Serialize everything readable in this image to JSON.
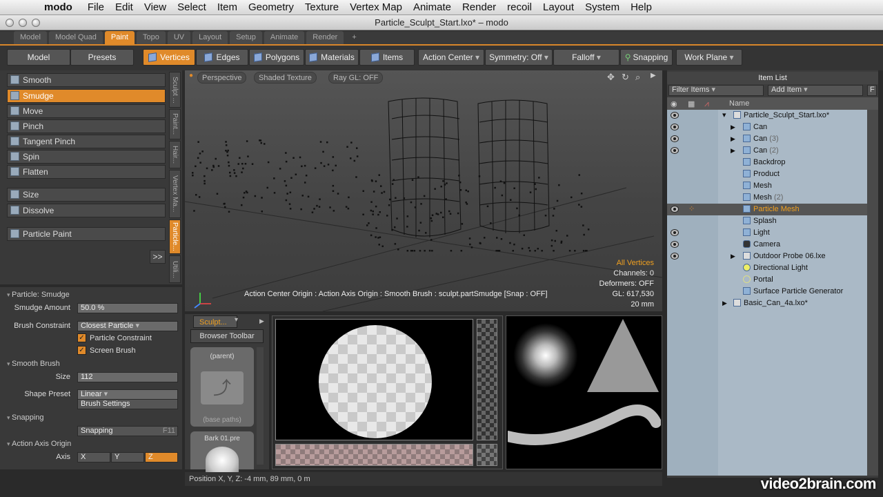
{
  "menubar": {
    "app": "modo",
    "items": [
      "File",
      "Edit",
      "View",
      "Select",
      "Item",
      "Geometry",
      "Texture",
      "Vertex Map",
      "Animate",
      "Render",
      "recoil",
      "Layout",
      "System",
      "Help"
    ]
  },
  "window": {
    "title": "Particle_Sculpt_Start.lxo* – modo"
  },
  "tabs": [
    "Model",
    "Model Quad",
    "Paint",
    "Topo",
    "UV",
    "Layout",
    "Setup",
    "Animate",
    "Render",
    "+"
  ],
  "toolbar": {
    "model": "Model",
    "presets": "Presets",
    "vertices": "Vertices",
    "edges": "Edges",
    "polygons": "Polygons",
    "materials": "Materials",
    "items": "Items",
    "action_center": "Action Center",
    "symmetry": "Symmetry: Off",
    "falloff": "Falloff",
    "snapping": "Snapping",
    "work_plane": "Work Plane"
  },
  "brushes": [
    "Smooth",
    "Smudge",
    "Move",
    "Pinch",
    "Tangent Pinch",
    "Spin",
    "Flatten"
  ],
  "brushes2": [
    "Size",
    "Dissolve"
  ],
  "particle_paint": "Particle Paint",
  "expand_btn": ">>",
  "vtabs": [
    "Sculpt ...",
    "Paint...",
    "Hair...",
    "Vertex Ma...",
    "Particle...",
    "Utili..."
  ],
  "props": {
    "section_title": "Particle: Smudge",
    "smudge_amount_label": "Smudge Amount",
    "smudge_amount": "50.0 %",
    "brush_constraint_label": "Brush Constraint",
    "brush_constraint": "Closest Particle",
    "particle_constraint": "Particle Constraint",
    "screen_brush": "Screen Brush",
    "smooth_brush": "Smooth Brush",
    "size_label": "Size",
    "size": "112",
    "shape_preset_label": "Shape Preset",
    "shape_preset": "Linear",
    "brush_settings": "Brush Settings",
    "snapping_section": "Snapping",
    "snapping": "Snapping",
    "snapping_key": "F11",
    "action_axis": "Action Axis Origin",
    "axis_label": "Axis",
    "axis_x": "X",
    "axis_y": "Y",
    "axis_z": "Z"
  },
  "viewport": {
    "perspective": "Perspective",
    "shading": "Shaded Texture",
    "raygl": "Ray GL: OFF",
    "overlay": [
      "All Vertices",
      "Channels: 0",
      "Deformers: OFF",
      "GL: 617,530",
      "20 mm"
    ],
    "status_line": "Action Center Origin : Action Axis Origin : Smooth Brush : sculpt.partSmudge  [Snap : OFF]"
  },
  "browser": {
    "tab": "Sculpt...",
    "toolbar_btn": "Browser Toolbar",
    "parent": "(parent)",
    "base_paths": "(base paths)",
    "item": "Bark 01.pre"
  },
  "statusbar": {
    "position": "Position X, Y, Z:  -4 mm, 89 mm, 0 m"
  },
  "itemlist": {
    "title": "Item List",
    "filter": "Filter Items",
    "add": "Add Item",
    "add_key": "F",
    "name_col": "Name",
    "items": [
      {
        "label": "Particle_Sculpt_Start.lxo*",
        "suffix": ""
      },
      {
        "label": "Can",
        "suffix": ""
      },
      {
        "label": "Can",
        "suffix": "(3)"
      },
      {
        "label": "Can",
        "suffix": "(2)"
      },
      {
        "label": "Backdrop",
        "suffix": ""
      },
      {
        "label": "Product",
        "suffix": ""
      },
      {
        "label": "Mesh",
        "suffix": ""
      },
      {
        "label": "Mesh",
        "suffix": "(2)"
      },
      {
        "label": "Particle Mesh",
        "suffix": ""
      },
      {
        "label": "Splash",
        "suffix": ""
      },
      {
        "label": "Light",
        "suffix": ""
      },
      {
        "label": "Camera",
        "suffix": ""
      },
      {
        "label": "Outdoor Probe 06.lxe",
        "suffix": ""
      },
      {
        "label": "Directional Light",
        "suffix": ""
      },
      {
        "label": "Portal",
        "suffix": ""
      },
      {
        "label": "Surface Particle Generator",
        "suffix": ""
      },
      {
        "label": "Basic_Can_4a.lxo*",
        "suffix": ""
      }
    ]
  },
  "watermark": "video2brain.com",
  "colors": {
    "accent": "#e08a2a",
    "panel": "#393939",
    "itemlist": "#aabbc9"
  }
}
